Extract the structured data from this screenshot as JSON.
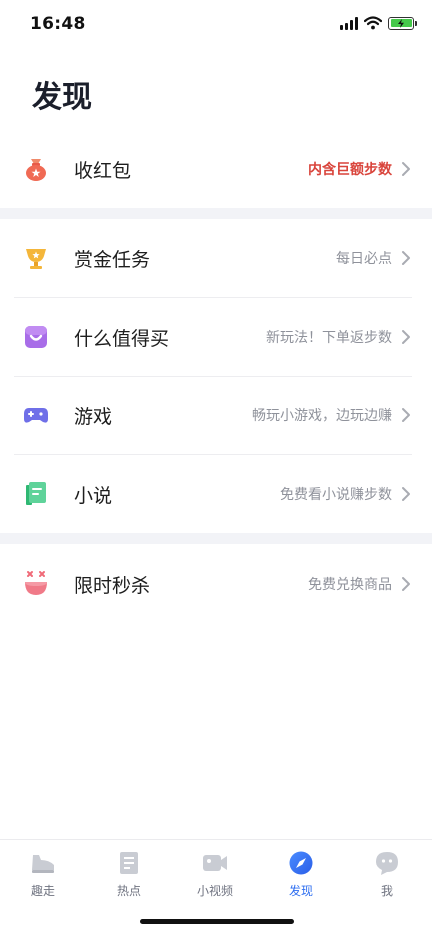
{
  "status_bar": {
    "time": "16:48",
    "battery_color": "#45c94a"
  },
  "page": {
    "title": "发现"
  },
  "rows": [
    {
      "icon": "red-envelope-icon",
      "label": "收红包",
      "subtitle": "内含巨额步数",
      "subtitle_color": "#d9443b"
    },
    {
      "icon": "trophy-icon",
      "label": "赏金任务",
      "subtitle": "每日必点"
    },
    {
      "icon": "shopping-bag-icon",
      "label": "什么值得买",
      "subtitle": "新玩法！下单返步数"
    },
    {
      "icon": "gamepad-icon",
      "label": "游戏",
      "subtitle": "畅玩小游戏，边玩边赚"
    },
    {
      "icon": "book-icon",
      "label": "小说",
      "subtitle": "免费看小说赚步数"
    },
    {
      "icon": "flash-sale-icon",
      "label": "限时秒杀",
      "subtitle": "免费兑换商品"
    }
  ],
  "tab_bar": {
    "tabs": [
      {
        "icon": "shoe-icon",
        "label": "趣走"
      },
      {
        "icon": "news-icon",
        "label": "热点"
      },
      {
        "icon": "video-camera-icon",
        "label": "小视频"
      },
      {
        "icon": "compass-icon",
        "label": "发现",
        "active": true
      },
      {
        "icon": "chat-bubble-icon",
        "label": "我"
      }
    ],
    "active_color": "#2e6ef0"
  }
}
